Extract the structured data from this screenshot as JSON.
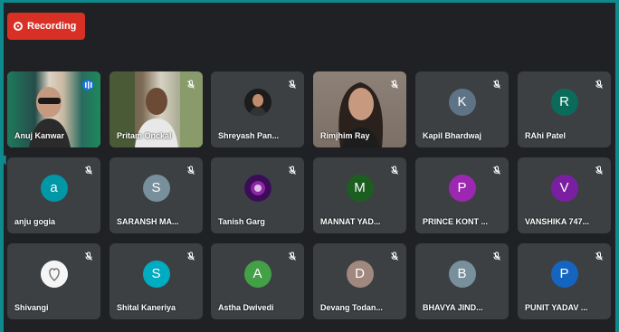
{
  "recording": {
    "label": "Recording"
  },
  "participants": [
    {
      "name": "Anuj Kanwar",
      "kind": "video",
      "speaking": true,
      "avatar_color": "#5f7f7b",
      "video": "speaker"
    },
    {
      "name": "Pritam Onckal",
      "kind": "video",
      "speaking": false,
      "avatar_color": "#7d7a62",
      "video": "office"
    },
    {
      "name": "Shreyash Pan...",
      "kind": "photo",
      "speaking": false,
      "avatar_color": "#222222"
    },
    {
      "name": "Rimjhim Ray",
      "kind": "video",
      "speaking": false,
      "avatar_color": "#8e8178",
      "video": "woman"
    },
    {
      "name": "Kapil Bhardwaj",
      "kind": "letter",
      "letter": "K",
      "speaking": false,
      "avatar_color": "#5f7387"
    },
    {
      "name": "RAhi Patel",
      "kind": "letter",
      "letter": "R",
      "speaking": false,
      "avatar_color": "#0b6b5a"
    },
    {
      "name": "anju gogia",
      "kind": "letter",
      "letter": "a",
      "speaking": false,
      "avatar_color": "#0097a7"
    },
    {
      "name": "SARANSH MA...",
      "kind": "letter",
      "letter": "S",
      "speaking": false,
      "avatar_color": "#78909c"
    },
    {
      "name": "Tanish Garg",
      "kind": "photo",
      "speaking": false,
      "avatar_color": "#7b1fa2"
    },
    {
      "name": "MANNAT YAD...",
      "kind": "letter",
      "letter": "M",
      "speaking": false,
      "avatar_color": "#1b5e20"
    },
    {
      "name": "PRINCE KONT ...",
      "kind": "letter",
      "letter": "P",
      "speaking": false,
      "avatar_color": "#9c27b0"
    },
    {
      "name": "VANSHIKA 747...",
      "kind": "letter",
      "letter": "V",
      "speaking": false,
      "avatar_color": "#7b1fa2"
    },
    {
      "name": "Shivangi",
      "kind": "photo",
      "speaking": false,
      "avatar_color": "#eeeeee"
    },
    {
      "name": "Shital Kaneriya",
      "kind": "letter",
      "letter": "S",
      "speaking": false,
      "avatar_color": "#00acc1"
    },
    {
      "name": "Astha Dwivedi",
      "kind": "letter",
      "letter": "A",
      "speaking": false,
      "avatar_color": "#43a047"
    },
    {
      "name": "Devang Todan...",
      "kind": "letter",
      "letter": "D",
      "speaking": false,
      "avatar_color": "#a1887f"
    },
    {
      "name": "BHAVYA JIND...",
      "kind": "letter",
      "letter": "B",
      "speaking": false,
      "avatar_color": "#78909c"
    },
    {
      "name": "PUNIT YADAV ...",
      "kind": "letter",
      "letter": "P",
      "speaking": false,
      "avatar_color": "#1565c0"
    }
  ],
  "icons": {
    "mic": "mic-off-icon",
    "recording": "recording-icon",
    "speaking": "audio-level-icon"
  }
}
